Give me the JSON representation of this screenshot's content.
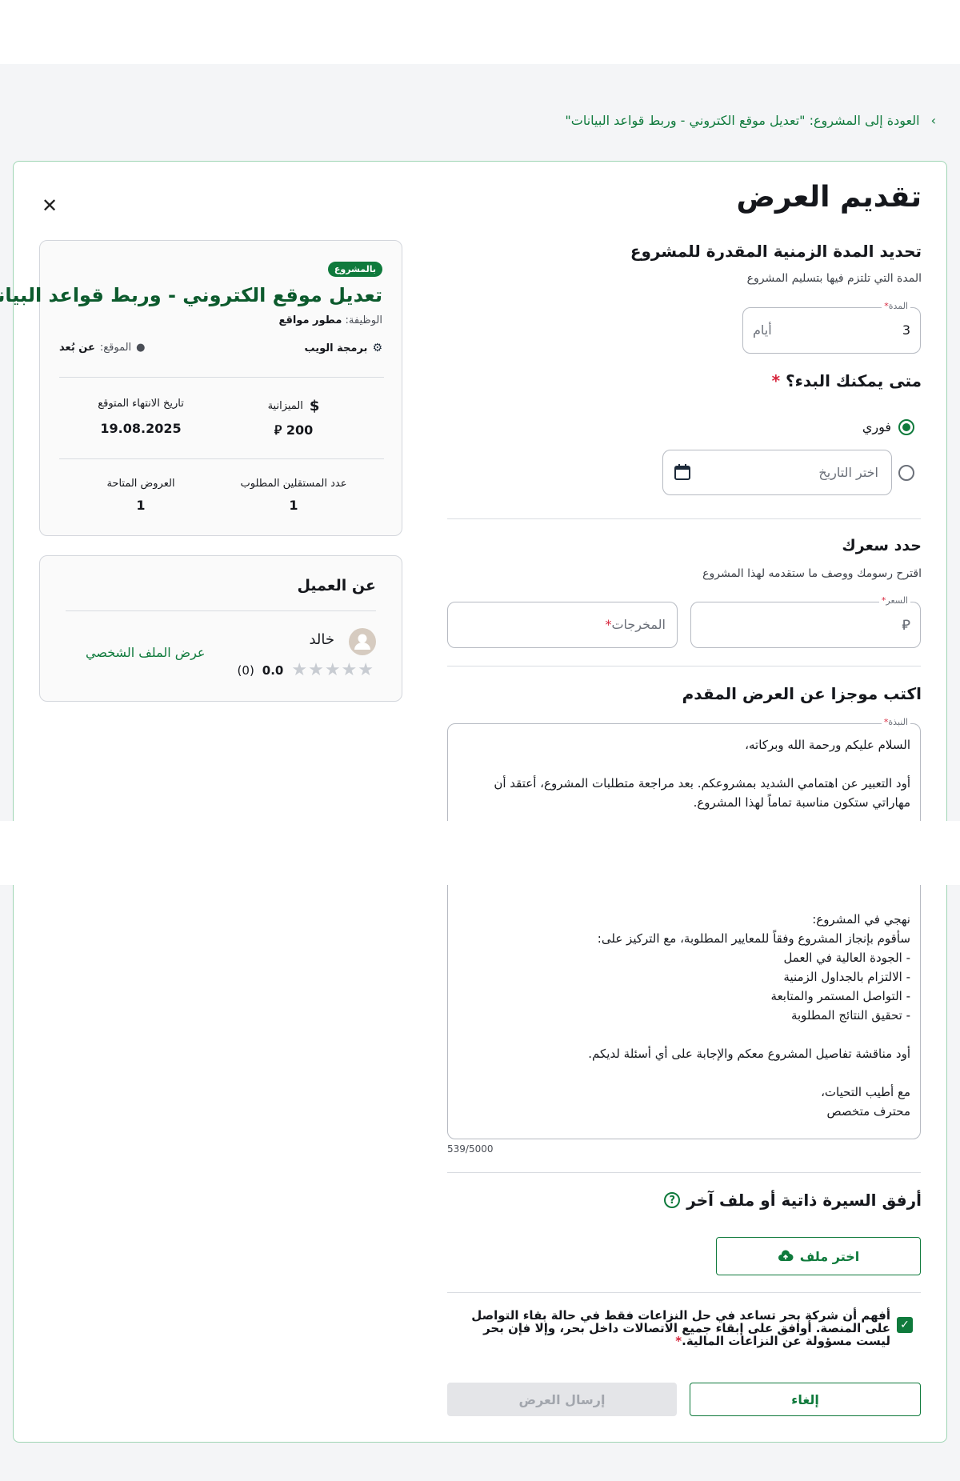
{
  "nav": {
    "back_label": "العودة إلى المشروع: \"تعديل موقع الكتروني - وربط قواعد البيانات\""
  },
  "form": {
    "title": "تقديم العرض",
    "duration": {
      "heading": "تحديد المدة الزمنية المقدرة للمشروع",
      "sub": "المدة التي تلتزم فيها بتسليم المشروع",
      "label": "المدة",
      "value": "3",
      "unit": "أيام"
    },
    "start": {
      "heading": "متى يمكنك البدء؟",
      "immediate": "فوري",
      "date_placeholder": "اختر التاريخ"
    },
    "price": {
      "heading": "حدد سعرك",
      "sub": "اقترح رسومك ووصف ما ستقدمه لهذا المشروع",
      "price_label": "السعر",
      "currency": "⃁",
      "deliverables_placeholder": "المخرجات"
    },
    "pitch": {
      "heading": "اكتب موجزا عن العرض المقدم",
      "label": "النبذة",
      "text_top": "السلام عليكم ورحمة الله وبركاته،\n\nأود التعبير عن اهتمامي الشديد بمشروعكم. بعد مراجعة متطلبات المشروع، أعتقد أن مهاراتي ستكون مناسبة تماماً لهذا المشروع.",
      "text_bottom": "نهجي في المشروع:\nسأقوم بإنجاز المشروع وفقاً للمعايير المطلوبة، مع التركيز على:\n- الجودة العالية في العمل\n- الالتزام بالجداول الزمنية\n- التواصل المستمر والمتابعة\n- تحقيق النتائج المطلوبة\n\nأود مناقشة تفاصيل المشروع معكم والإجابة على أي أسئلة لديكم.\n\nمع أطيب التحيات،\nمحترف متخصص",
      "counter": "539/5000"
    },
    "attach": {
      "heading": "أرفق السيرة ذاتية أو ملف آخر",
      "button": "اختر ملف"
    },
    "agreement": "أفهم أن شركة بحر تساعد في حل النزاعات فقط في حالة بقاء التواصل على المنصة. أوافق على إبقاء جميع الاتصالات داخل بحر، وإلا فإن بحر ليست مسؤولة عن النزاعات المالية.",
    "cancel": "إلغاء",
    "submit": "إرسال العرض"
  },
  "project": {
    "badge": "بالمشروع",
    "title": "تعديل موقع الكتروني - وربط قواعد البيانات",
    "job_label": "الوظيفة:",
    "job_value": "مطور مواقع",
    "category": "برمجة الويب",
    "location_label": "الموقع:",
    "location_value": "عن بُعد",
    "budget_label": "الميزانية",
    "budget_value": "200",
    "end_label": "تاريخ الانتهاء المتوقع",
    "end_value": "19.08.2025",
    "freelancers_label": "عدد المستقلين المطلوب",
    "freelancers_value": "1",
    "offers_label": "العروض المتاحة",
    "offers_value": "1"
  },
  "client": {
    "heading": "عن العميل",
    "name": "خالد",
    "rating": "0.0",
    "reviews": "(0)",
    "profile_link": "عرض الملف الشخصي"
  },
  "colors": {
    "accent": "#0f7a3c",
    "required": "#d7263d"
  }
}
